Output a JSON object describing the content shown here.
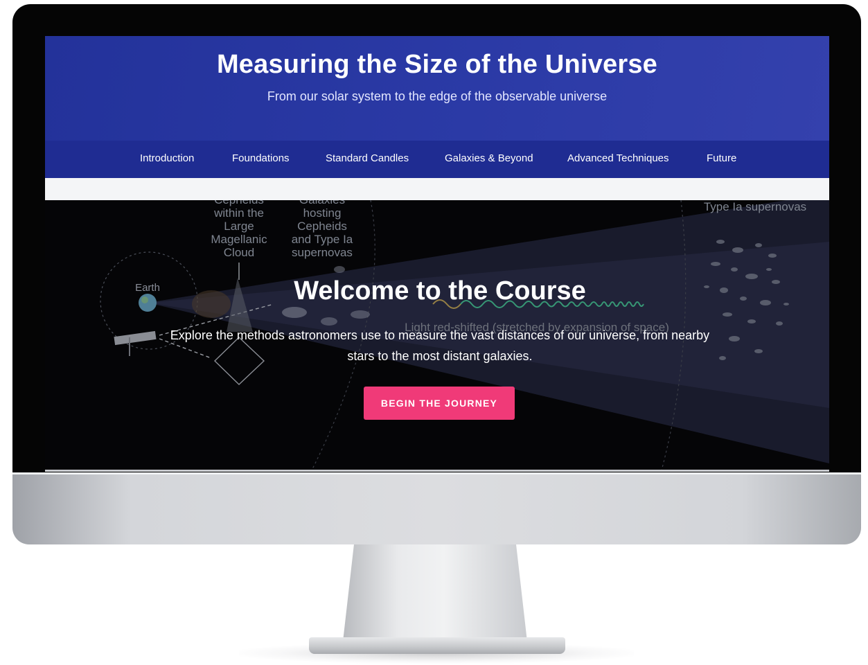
{
  "header": {
    "title": "Measuring the Size of the Universe",
    "subtitle": "From our solar system to the edge of the observable universe"
  },
  "nav": {
    "items": [
      {
        "label": "Introduction"
      },
      {
        "label": "Foundations"
      },
      {
        "label": "Standard Candles"
      },
      {
        "label": "Galaxies & Beyond"
      },
      {
        "label": "Advanced Techniques"
      },
      {
        "label": "Future"
      }
    ]
  },
  "illustration": {
    "cepheids_label": [
      "Cepheids",
      "within the",
      "Large",
      "Magellanic",
      "Cloud"
    ],
    "galaxies_label": [
      "Galaxies",
      "hosting",
      "Cepheids",
      "and Type Ia",
      "supernovas"
    ],
    "supernovas_label": "Type Ia supernovas",
    "earth_label": "Earth",
    "redshift_label": "Light red-shifted (stretched by expansion of space)"
  },
  "hero": {
    "title": "Welcome to the Course",
    "description": "Explore the methods astronomers use to measure the vast distances of our universe, from nearby stars to the most distant galaxies.",
    "cta_label": "BEGIN THE JOURNEY"
  },
  "colors": {
    "header_blue": "#2b3aa6",
    "nav_blue": "#1f2c92",
    "cta_pink": "#f03a78",
    "hero_bg": "#050507"
  }
}
